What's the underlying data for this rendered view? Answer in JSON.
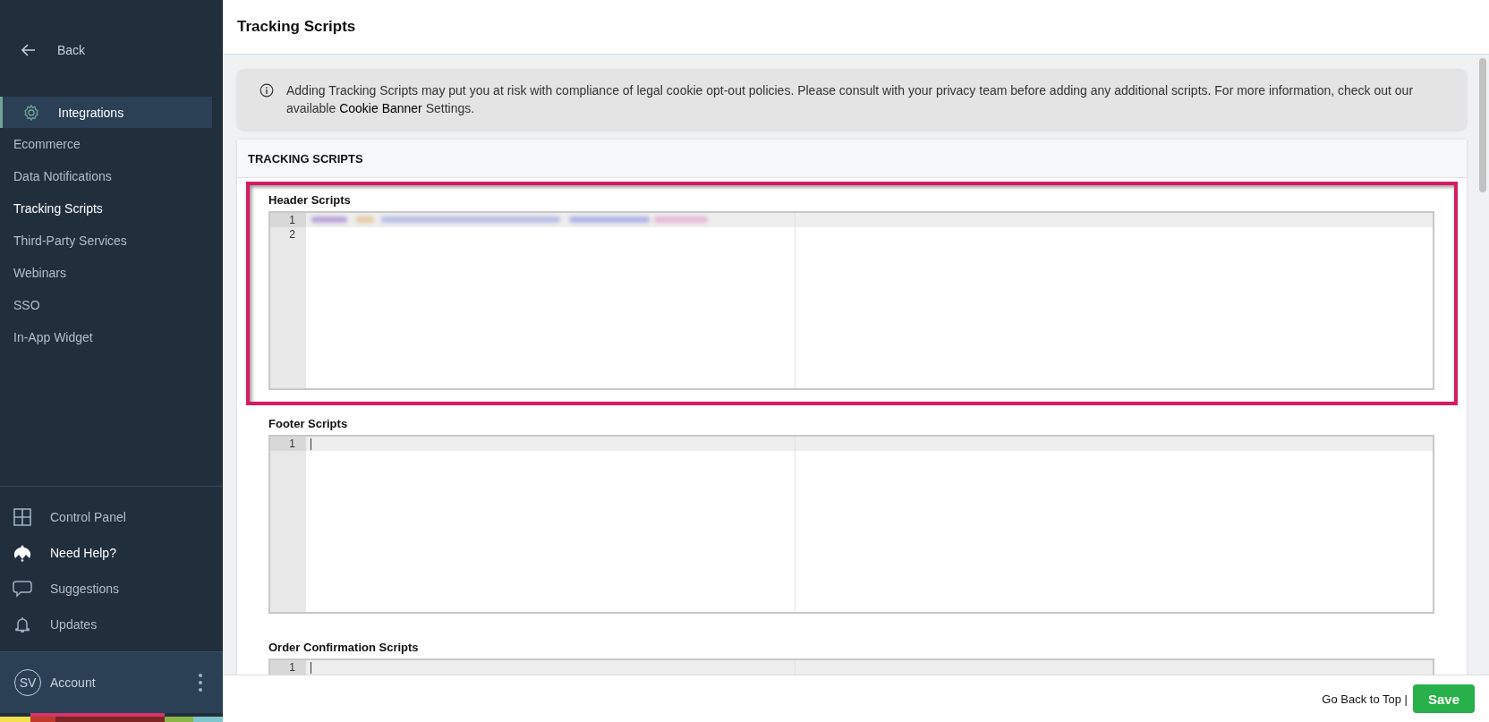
{
  "sidebar": {
    "back": {
      "label": "Back"
    },
    "section": {
      "label": "Integrations",
      "selected": true
    },
    "items": [
      {
        "label": "Ecommerce",
        "selected": false
      },
      {
        "label": "Data Notifications",
        "selected": false
      },
      {
        "label": "Tracking Scripts",
        "selected": true
      },
      {
        "label": "Third-Party Services",
        "selected": false
      },
      {
        "label": "Webinars",
        "selected": false
      },
      {
        "label": "SSO",
        "selected": false
      },
      {
        "label": "In-App Widget",
        "selected": false
      }
    ],
    "bottom_items": [
      {
        "label": "Control Panel",
        "kind": "grid",
        "emphasized": false
      },
      {
        "label": "Need Help?",
        "kind": "help",
        "emphasized": true
      },
      {
        "label": "Suggestions",
        "kind": "chat",
        "emphasized": false
      },
      {
        "label": "Updates",
        "kind": "bell",
        "emphasized": false
      }
    ],
    "account": {
      "initials": "SV",
      "label": "Account"
    }
  },
  "page": {
    "title": "Tracking Scripts"
  },
  "notice": {
    "text_before": "Adding Tracking Scripts may put you at risk with compliance of legal cookie opt-out policies. Please consult with your privacy team before adding any additional scripts. For more information, check out our available",
    "link": "Cookie Banner",
    "text_after": "Settings."
  },
  "card": {
    "title": "TRACKING SCRIPTS",
    "editors": [
      {
        "label": "Header Scripts",
        "highlighted": true,
        "redacted": true,
        "line_numbers": [
          "1",
          "2"
        ]
      },
      {
        "label": "Footer Scripts",
        "highlighted": false,
        "redacted": false,
        "line_numbers": [
          "1"
        ]
      },
      {
        "label": "Order Confirmation Scripts",
        "highlighted": false,
        "redacted": false,
        "line_numbers": [
          "1"
        ]
      }
    ]
  },
  "footer": {
    "link": "Go Back to Top |",
    "save": "Save"
  }
}
